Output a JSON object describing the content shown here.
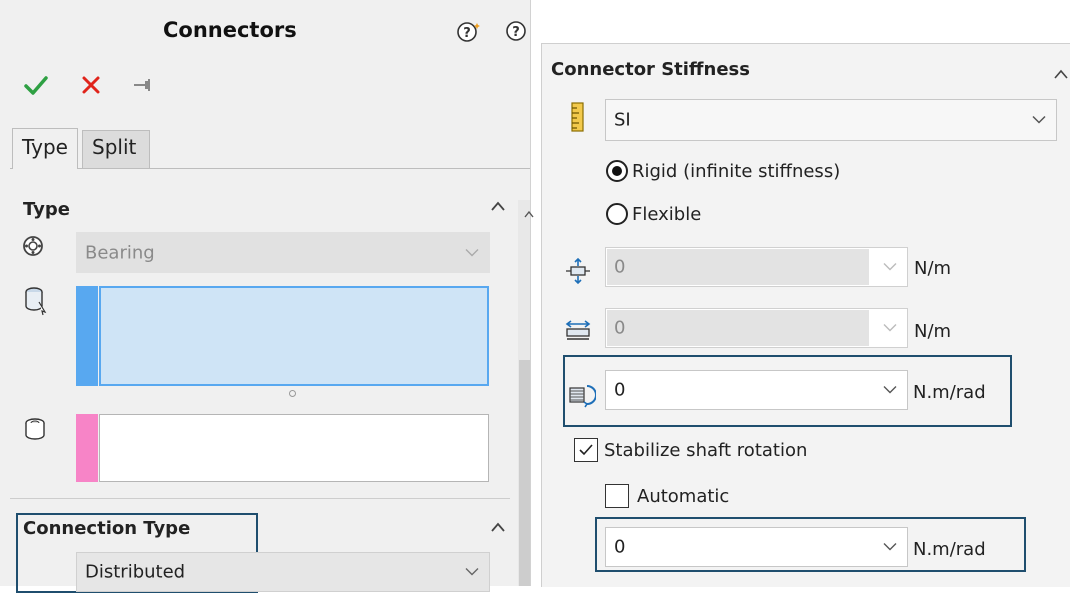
{
  "left": {
    "title": "Connectors",
    "tabs": [
      {
        "label": "Type"
      },
      {
        "label": "Split"
      }
    ],
    "type_section": {
      "title": "Type",
      "connector_type": "Bearing"
    },
    "connection_type_section": {
      "title": "Connection Type",
      "value": "Distributed"
    }
  },
  "right": {
    "title": "Connector Stiffness",
    "units": "SI",
    "options": [
      {
        "label": "Rigid (infinite stiffness)",
        "checked": true
      },
      {
        "label": "Flexible",
        "checked": false
      }
    ],
    "axial_stiffness": {
      "value": "0",
      "unit": "N/m"
    },
    "lateral_stiffness": {
      "value": "0",
      "unit": "N/m"
    },
    "rotational_stiffness": {
      "value": "0",
      "unit": "N.m/rad"
    },
    "stabilize": {
      "label": "Stabilize shaft rotation",
      "checked": true
    },
    "automatic": {
      "label": "Automatic",
      "checked": false
    },
    "stabilize_value": {
      "value": "0",
      "unit": "N.m/rad"
    }
  },
  "colors": {
    "ok": "#2ea043",
    "cancel": "#e0241b",
    "highlight_border": "#1f4e6e",
    "selection_blue": "#58a8f0",
    "selection_pink": "#f784c7"
  }
}
